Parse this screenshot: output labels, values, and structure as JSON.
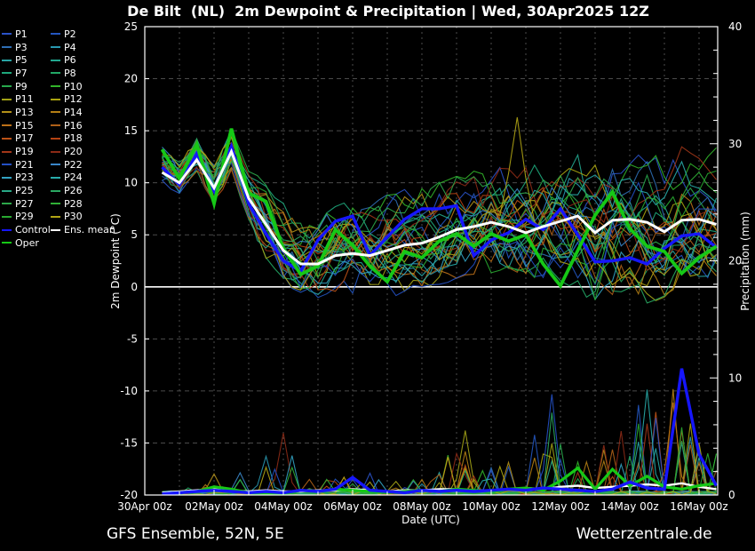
{
  "title": "De Bilt  (NL)  2m Dewpoint & Precipitation | Wed, 30Apr2025 12Z",
  "footer": {
    "left": "GFS Ensemble, 52N, 5E",
    "right": "Wetterzentrale.de"
  },
  "legend": {
    "col1": [
      "P1",
      "P3",
      "P5",
      "P7",
      "P9",
      "P11",
      "P13",
      "P15",
      "P17",
      "P19",
      "P21",
      "P23",
      "P25",
      "P27",
      "P29",
      "Control",
      "Oper"
    ],
    "col2": [
      "P2",
      "P4",
      "P6",
      "P8",
      "P10",
      "P12",
      "P14",
      "P16",
      "P18",
      "P20",
      "P22",
      "P24",
      "P26",
      "P28",
      "P30",
      "Ens. mean"
    ]
  },
  "chart_data": {
    "type": "line",
    "title": "De Bilt  (NL)  2m Dewpoint & Precipitation | Wed, 30Apr2025 12Z",
    "xlabel": "Date (UTC)",
    "ylabel_left": "2m Dewpoint (°C)",
    "ylabel_right": "Precipitation (mm)",
    "y_left_range": [
      -20,
      25
    ],
    "y_left_ticks": [
      25,
      20,
      15,
      10,
      5,
      0,
      -5,
      -10,
      -15,
      -20
    ],
    "y_left_gridlines": [
      20,
      15,
      10,
      5,
      -5,
      -10,
      -15
    ],
    "zero_line_c": 0,
    "y_right_range": [
      0,
      40
    ],
    "y_right_ticks": [
      40,
      30,
      20,
      10,
      0
    ],
    "y_right_minor_step_mm": 2,
    "x_range_days": [
      0,
      16.54
    ],
    "x_ticks": [
      {
        "label": "30Apr 00z",
        "day": 0
      },
      {
        "label": "02May 00z",
        "day": 2
      },
      {
        "label": "04May 00z",
        "day": 4
      },
      {
        "label": "06May 00z",
        "day": 6
      },
      {
        "label": "08May 00z",
        "day": 8
      },
      {
        "label": "10May 00z",
        "day": 10
      },
      {
        "label": "12May 00z",
        "day": 12
      },
      {
        "label": "14May 00z",
        "day": 14
      },
      {
        "label": "16May 00z",
        "day": 16
      }
    ],
    "grid": "dashed, every 1 day vertical, every 5C horizontal",
    "legend_position": "top-left, outside plot",
    "time_hours_since_30Apr00z": [
      12,
      24,
      36,
      48,
      60,
      72,
      84,
      96,
      108,
      120,
      132,
      144,
      156,
      168,
      180,
      192,
      204,
      216,
      228,
      240,
      252,
      264,
      276,
      288,
      300,
      312,
      324,
      336,
      348,
      360,
      372,
      384,
      396
    ],
    "members": [
      "P1",
      "P2",
      "P3",
      "P4",
      "P5",
      "P6",
      "P7",
      "P8",
      "P9",
      "P10",
      "P11",
      "P12",
      "P13",
      "P14",
      "P15",
      "P16",
      "P17",
      "P18",
      "P19",
      "P20",
      "P21",
      "P22",
      "P23",
      "P24",
      "P25",
      "P26",
      "P27",
      "P28",
      "P29",
      "P30"
    ],
    "colors": {
      "P1": "#2a52c8",
      "P2": "#2456c0",
      "P3": "#2e6eb4",
      "P4": "#2898b0",
      "P5": "#28a4a4",
      "P6": "#22a890",
      "P7": "#1ea87c",
      "P8": "#22a866",
      "P9": "#28a84c",
      "P10": "#32b42a",
      "P11": "#a2a216",
      "P12": "#aaa410",
      "P13": "#b29018",
      "P14": "#b47e14",
      "P15": "#bc7018",
      "P16": "#ae6018",
      "P17": "#bc5216",
      "P18": "#b44212",
      "P19": "#a23618",
      "P20": "#8c2a16",
      "P21": "#2450c4",
      "P22": "#3a86c8",
      "P23": "#32a2c2",
      "P24": "#28acaa",
      "P25": "#28a886",
      "P26": "#2aa862",
      "P27": "#2ca84a",
      "P28": "#30b036",
      "P29": "#28a830",
      "P30": "#b0a414",
      "Control": "#1616ff",
      "Ens. mean": "#ffffff",
      "Oper": "#16c816",
      "grid": "#4b4b4b",
      "frame": "#ffffff",
      "background": "#000000"
    },
    "series": {
      "oper_dewpoint": [
        13.2,
        10.4,
        13.7,
        8.0,
        15.2,
        9.0,
        8.2,
        3.7,
        1.2,
        2.0,
        5.5,
        4.0,
        2.0,
        0.5,
        3.4,
        2.8,
        4.4,
        5.1,
        3.9,
        5.1,
        4.4,
        5.0,
        2.2,
        0.1,
        3.5,
        6.9,
        9.1,
        5.6,
        3.9,
        3.4,
        1.3,
        2.8,
        3.9
      ],
      "control_dewpoint": [
        11.5,
        9.8,
        12.8,
        9.2,
        13.5,
        8.0,
        5.1,
        2.5,
        1.5,
        4.5,
        6.3,
        6.8,
        3.0,
        4.8,
        6.5,
        7.5,
        7.5,
        7.8,
        3.0,
        4.5,
        5.2,
        6.5,
        5.5,
        7.5,
        5.0,
        2.4,
        2.5,
        2.8,
        2.2,
        3.7,
        4.9,
        5.1,
        3.8
      ],
      "ens_mean_dewpoint": [
        11.0,
        10.0,
        12.2,
        9.5,
        13.0,
        8.5,
        6.0,
        3.5,
        2.2,
        2.2,
        3.0,
        3.2,
        3.0,
        3.5,
        4.0,
        4.2,
        4.8,
        5.5,
        5.8,
        6.2,
        5.8,
        5.2,
        5.8,
        6.3,
        6.8,
        5.2,
        6.4,
        6.5,
        6.2,
        5.3,
        6.4,
        6.5,
        6.0
      ],
      "member_envelope_min": [
        10.2,
        8.5,
        11.0,
        7.6,
        10.5,
        5.0,
        2.5,
        0.5,
        -1.0,
        -1.5,
        -0.5,
        -2.0,
        -1.5,
        -2.5,
        -0.5,
        0.0,
        0.0,
        0.5,
        1.0,
        1.0,
        1.5,
        1.0,
        0.5,
        0.5,
        -0.5,
        -1.5,
        -3.5,
        -3.0,
        -2.0,
        -1.0,
        0.0,
        0.5,
        1.0
      ],
      "member_envelope_max": [
        13.5,
        12.0,
        14.3,
        12.0,
        15.5,
        11.5,
        10.5,
        8.5,
        7.0,
        7.5,
        8.0,
        8.5,
        8.0,
        9.0,
        9.5,
        10.0,
        10.5,
        11.0,
        11.5,
        11.0,
        16.3,
        13.0,
        12.5,
        14.0,
        15.0,
        13.0,
        13.5,
        13.0,
        12.5,
        13.0,
        13.5,
        13.0,
        13.5
      ],
      "oper_precip": [
        0.1,
        0.2,
        0.3,
        0.7,
        0.5,
        0.2,
        0.1,
        0.1,
        0.4,
        0.3,
        0.5,
        0.4,
        0.3,
        0.2,
        0.3,
        0.4,
        0.3,
        0.5,
        0.4,
        0.3,
        0.5,
        0.6,
        0.4,
        1.2,
        2.3,
        0.5,
        2.2,
        0.8,
        1.6,
        0.7,
        0.5,
        0.8,
        1.0
      ],
      "control_precip": [
        0.1,
        0.2,
        0.3,
        0.4,
        0.3,
        0.2,
        0.3,
        0.2,
        0.4,
        0.3,
        0.5,
        1.5,
        0.4,
        0.3,
        0.2,
        0.4,
        0.3,
        0.4,
        0.3,
        0.4,
        0.5,
        0.4,
        0.6,
        0.5,
        0.4,
        0.3,
        0.5,
        1.1,
        0.6,
        0.5,
        10.8,
        3.5,
        0.8
      ],
      "ens_mean_precip": [
        0.2,
        0.3,
        0.4,
        0.5,
        0.4,
        0.3,
        0.4,
        0.3,
        0.3,
        0.4,
        0.4,
        0.5,
        0.4,
        0.3,
        0.4,
        0.4,
        0.5,
        0.5,
        0.4,
        0.4,
        0.5,
        0.6,
        0.5,
        0.7,
        0.8,
        0.6,
        0.7,
        0.8,
        0.9,
        0.8,
        1.0,
        0.7,
        0.5
      ],
      "member_precip_max": [
        0.3,
        0.5,
        0.8,
        1.9,
        1.4,
        2.0,
        3.3,
        5.3,
        1.5,
        1.2,
        1.5,
        1.8,
        2.4,
        1.5,
        1.2,
        1.5,
        2.0,
        5.5,
        3.5,
        3.0,
        3.2,
        3.0,
        8.6,
        5.5,
        3.0,
        4.5,
        5.0,
        6.5,
        9.0,
        7.9,
        10.8,
        5.0,
        4.0
      ]
    },
    "notable_member_spikes": [
      {
        "member": "P13",
        "time": "02May 00z",
        "t_hours": 48,
        "precip_mm": 1.8
      },
      {
        "member": "P22",
        "time": "02May 18z",
        "t_hours": 66,
        "precip_mm": 1.9
      },
      {
        "member": "P4",
        "time": "03May 12z",
        "t_hours": 84,
        "precip_mm": 3.3
      },
      {
        "member": "P20",
        "time": "04May 00z",
        "t_hours": 96,
        "precip_mm": 5.3
      },
      {
        "member": "P11",
        "time": "09May 06z",
        "t_hours": 222,
        "precip_mm": 5.5
      },
      {
        "member": "P21",
        "time": "11May 18z",
        "t_hours": 282,
        "precip_mm": 8.6
      },
      {
        "member": "P24",
        "time": "14May 12z",
        "t_hours": 348,
        "precip_mm": 9.0
      },
      {
        "member": "P15",
        "time": "15May 06z",
        "t_hours": 366,
        "precip_mm": 7.9
      },
      {
        "member": "P30",
        "time": "10May 18z",
        "t_hours": 258,
        "dewpoint_c": 16.3
      }
    ]
  }
}
